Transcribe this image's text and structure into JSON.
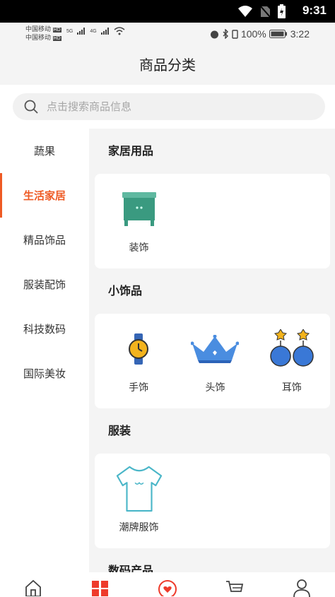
{
  "system_bar": {
    "time": "9:31"
  },
  "status_bar": {
    "carrier_1": "中国移动",
    "carrier_2": "中国移动",
    "net_1": "5G",
    "net_2": "4G",
    "battery_pct": "100%",
    "clock": "3:22"
  },
  "header": {
    "title": "商品分类"
  },
  "search": {
    "placeholder": "点击搜索商品信息"
  },
  "sidebar": {
    "items": [
      {
        "label": "蔬果",
        "active": false
      },
      {
        "label": "生活家居",
        "active": true
      },
      {
        "label": "精品饰品",
        "active": false
      },
      {
        "label": "服装配饰",
        "active": false
      },
      {
        "label": "科技数码",
        "active": false
      },
      {
        "label": "国际美妆",
        "active": false
      }
    ]
  },
  "sections": [
    {
      "title": "家居用品",
      "items": [
        {
          "label": "装饰",
          "icon": "cabinet-icon"
        }
      ]
    },
    {
      "title": "小饰品",
      "items": [
        {
          "label": "手饰",
          "icon": "watch-icon"
        },
        {
          "label": "头饰",
          "icon": "crown-icon"
        },
        {
          "label": "耳饰",
          "icon": "earring-icon"
        }
      ]
    },
    {
      "title": "服装",
      "items": [
        {
          "label": "潮牌服饰",
          "icon": "tshirt-icon"
        }
      ]
    },
    {
      "title": "数码产品",
      "items": []
    }
  ],
  "tabbar": {
    "tabs": [
      "home-icon",
      "category-icon",
      "heart-icon",
      "cart-icon",
      "profile-icon"
    ],
    "active_color": "#ee3b2b"
  },
  "colors": {
    "accent": "#ee5a24"
  }
}
